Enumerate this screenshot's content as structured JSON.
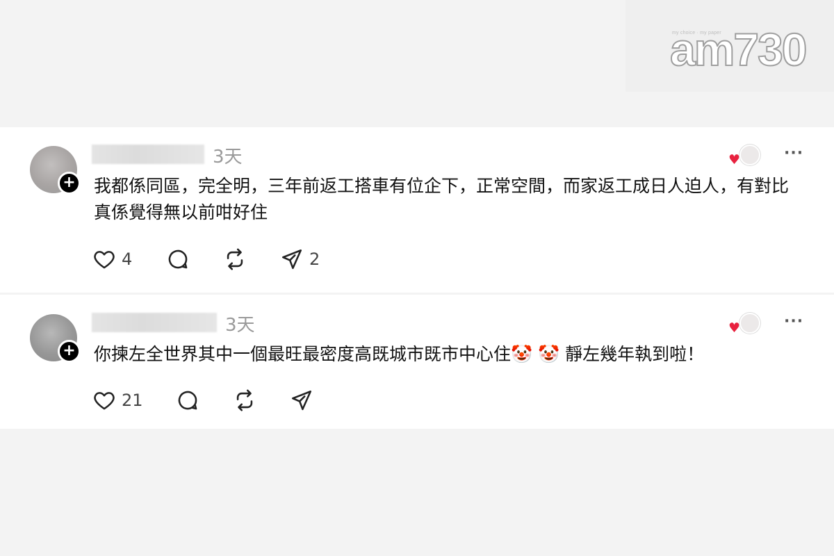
{
  "watermark": {
    "tagline": "my choice · my paper",
    "logo_text": "am730"
  },
  "posts": [
    {
      "time": "3天",
      "body": "我都係同區，完全明，三年前返工搭車有位企下，正常空間，而家返工成日人迫人，有對比真係覺得無以前咁好住",
      "more": "···",
      "actions": {
        "likes": "4",
        "shares": "2"
      }
    },
    {
      "time": "3天",
      "body": "你揀左全世界其中一個最旺最密度高既城市既市中心住🤡 🤡 靜左幾年執到啦！",
      "more": "···",
      "actions": {
        "likes": "21",
        "shares": ""
      }
    }
  ],
  "icons": {
    "follow": "plus-icon",
    "like": "heart-outline-icon",
    "reply": "speech-bubble-icon",
    "repost": "repost-icon",
    "share": "send-icon",
    "liked_by_author": "heart-filled-icon"
  },
  "colors": {
    "heart_red": "#e8223f",
    "time_gray": "#9a9a9a",
    "background": "#f3f3f3"
  }
}
